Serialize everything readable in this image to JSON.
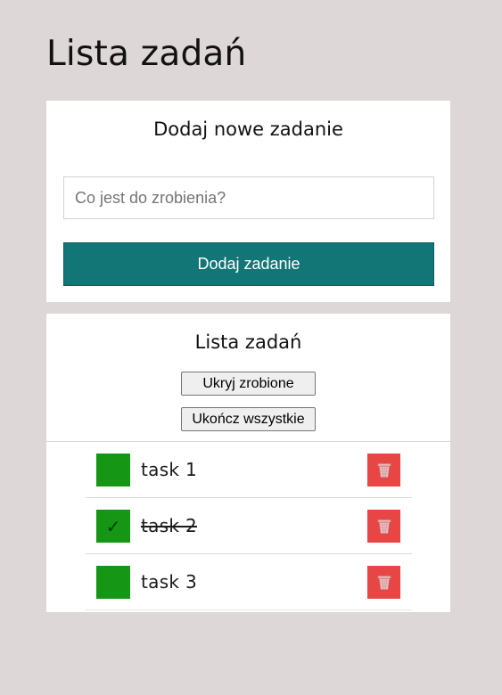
{
  "page": {
    "title": "Lista zadań"
  },
  "add_card": {
    "heading": "Dodaj nowe zadanie",
    "input_placeholder": "Co jest do zrobienia?",
    "input_value": "",
    "add_button_label": "Dodaj zadanie"
  },
  "list_card": {
    "heading": "Lista zadań",
    "hide_done_label": "Ukryj zrobione",
    "complete_all_label": "Ukończ wszystkie",
    "tasks": [
      {
        "text": "task 1",
        "done": false,
        "check_mark": ""
      },
      {
        "text": "task 2",
        "done": true,
        "check_mark": "✓"
      },
      {
        "text": "task 3",
        "done": false,
        "check_mark": ""
      }
    ]
  },
  "icons": {
    "checkbox": "checkbox-icon",
    "delete": "trash-icon"
  },
  "colors": {
    "background": "#ddd7d7",
    "accent": "#137676",
    "checkbox": "#159615",
    "delete": "#e84545"
  }
}
